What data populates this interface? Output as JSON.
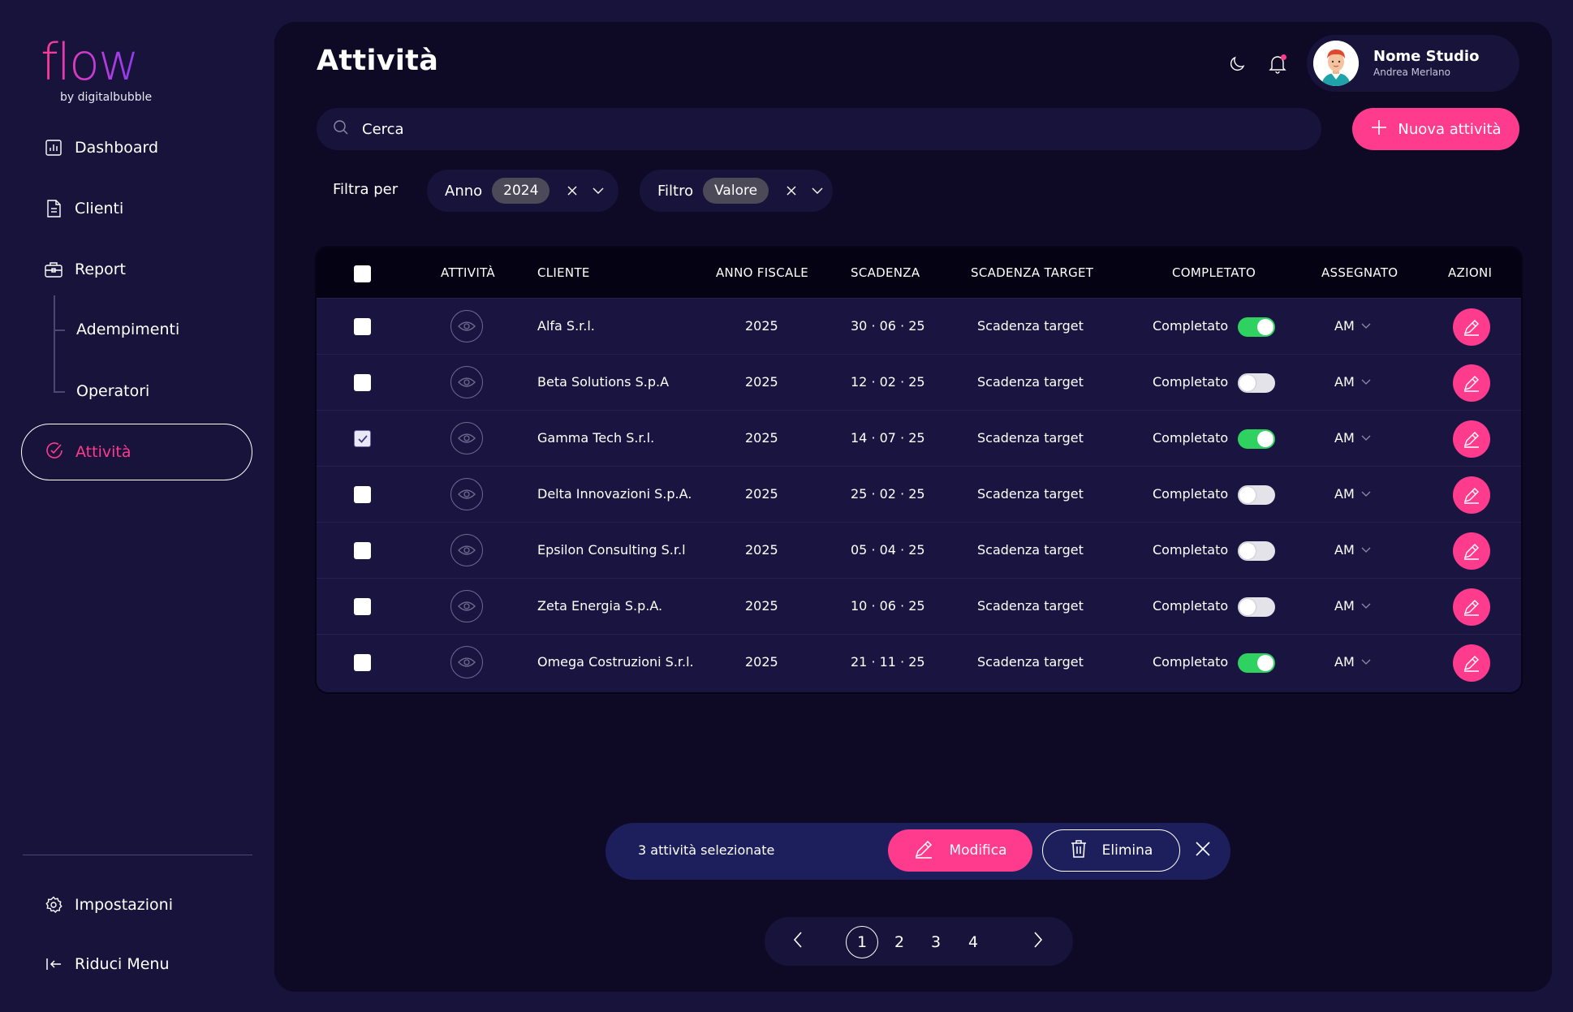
{
  "brand": {
    "logo_text": "flow",
    "tagline": "by digitalbubble"
  },
  "sidebar": {
    "items": [
      {
        "label": "Dashboard",
        "icon": "chart-icon"
      },
      {
        "label": "Clienti",
        "icon": "document-icon"
      },
      {
        "label": "Report",
        "icon": "briefcase-icon"
      }
    ],
    "sub_items": [
      {
        "label": "Adempimenti"
      },
      {
        "label": "Operatori"
      }
    ],
    "active": {
      "label": "Attività",
      "icon": "check-circle-icon"
    },
    "bottom": [
      {
        "label": "Impostazioni",
        "icon": "gear-icon"
      },
      {
        "label": "Riduci Menu",
        "icon": "collapse-icon"
      }
    ]
  },
  "header": {
    "title": "Attività",
    "profile": {
      "name": "Nome Studio",
      "user": "Andrea Merlano"
    }
  },
  "search": {
    "placeholder": "Cerca"
  },
  "new_button": {
    "label": "Nuova attività"
  },
  "filters": {
    "label": "Filtra per",
    "chips": [
      {
        "label": "Anno",
        "value": "2024"
      },
      {
        "label": "Filtro",
        "value": "Valore"
      }
    ]
  },
  "table": {
    "columns": [
      "ATTIVITÀ",
      "CLIENTE",
      "ANNO FISCALE",
      "SCADENZA",
      "SCADENZA TARGET",
      "COMPLETATO",
      "ASSEGNATO",
      "AZIONI"
    ],
    "rows": [
      {
        "checked": false,
        "cliente": "Alfa S.r.l.",
        "anno": "2025",
        "scadenza": "30 · 06 · 25",
        "target": "Scadenza target",
        "completato_label": "Completato",
        "completato": true,
        "assegnato": "AM"
      },
      {
        "checked": false,
        "cliente": "Beta Solutions S.p.A",
        "anno": "2025",
        "scadenza": "12 · 02 · 25",
        "target": "Scadenza target",
        "completato_label": "Completato",
        "completato": false,
        "assegnato": "AM"
      },
      {
        "checked": true,
        "cliente": "Gamma Tech S.r.l.",
        "anno": "2025",
        "scadenza": "14 · 07 · 25",
        "target": "Scadenza target",
        "completato_label": "Completato",
        "completato": true,
        "assegnato": "AM"
      },
      {
        "checked": false,
        "cliente": "Delta Innovazioni S.p.A.",
        "anno": "2025",
        "scadenza": "25 · 02 · 25",
        "target": "Scadenza target",
        "completato_label": "Completato",
        "completato": false,
        "assegnato": "AM"
      },
      {
        "checked": false,
        "cliente": "Epsilon Consulting S.r.l",
        "anno": "2025",
        "scadenza": "05 · 04 · 25",
        "target": "Scadenza target",
        "completato_label": "Completato",
        "completato": false,
        "assegnato": "AM"
      },
      {
        "checked": false,
        "cliente": "Zeta Energia S.p.A.",
        "anno": "2025",
        "scadenza": "10 · 06 · 25",
        "target": "Scadenza target",
        "completato_label": "Completato",
        "completato": false,
        "assegnato": "AM"
      },
      {
        "checked": false,
        "cliente": "Omega Costruzioni S.r.l.",
        "anno": "2025",
        "scadenza": "21 · 11 · 25",
        "target": "Scadenza target",
        "completato_label": "Completato",
        "completato": true,
        "assegnato": "AM"
      }
    ]
  },
  "bulk_bar": {
    "text": "3 attività selezionate",
    "edit_label": "Modifica",
    "delete_label": "Elimina"
  },
  "pagination": {
    "pages": [
      "1",
      "2",
      "3",
      "4"
    ],
    "current": "1"
  },
  "colors": {
    "accent": "#ff3b8e",
    "background": "#18133a",
    "panel": "#0e0a26",
    "toggle_on": "#2fd160"
  }
}
